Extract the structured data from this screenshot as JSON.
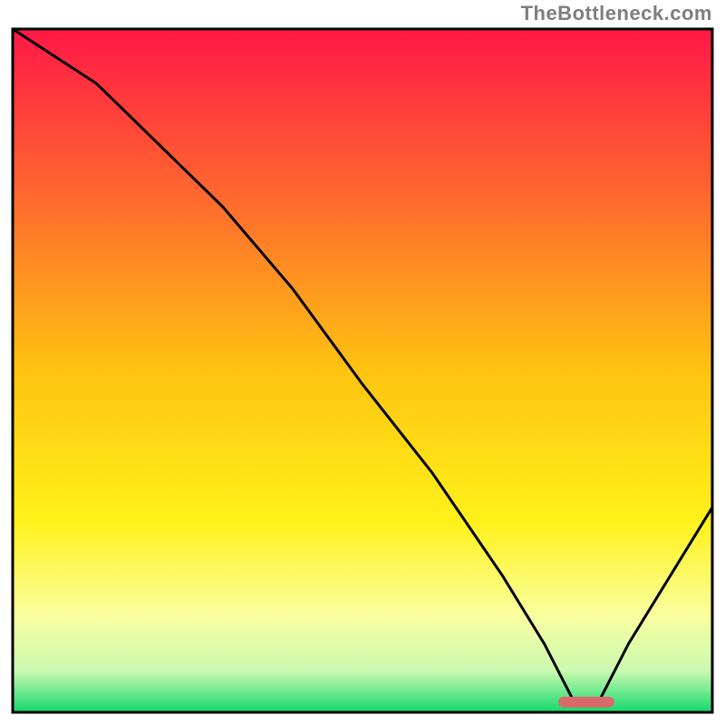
{
  "attribution": "TheBottleneck.com",
  "chart_data": {
    "type": "line",
    "title": "",
    "xlabel": "",
    "ylabel": "",
    "xlim": [
      0,
      100
    ],
    "ylim": [
      0,
      100
    ],
    "grid": false,
    "legend": false,
    "series": [
      {
        "name": "bottleneck-curve",
        "x": [
          0,
          12,
          24,
          30,
          40,
          50,
          60,
          70,
          76,
          80,
          84,
          88,
          100
        ],
        "y": [
          100,
          92,
          80,
          74,
          62,
          48,
          35,
          20,
          10,
          2,
          2,
          10,
          30
        ]
      }
    ],
    "marker": {
      "name": "optimal-range",
      "x_start": 78,
      "x_end": 86,
      "y": 1.5,
      "color": "#d86a6a"
    },
    "background_gradient": {
      "stops": [
        {
          "offset": 0.0,
          "color": "#ff1846"
        },
        {
          "offset": 0.25,
          "color": "#ff6a2e"
        },
        {
          "offset": 0.5,
          "color": "#ffc310"
        },
        {
          "offset": 0.72,
          "color": "#fff11a"
        },
        {
          "offset": 0.86,
          "color": "#f9ffa0"
        },
        {
          "offset": 0.94,
          "color": "#c9f9b0"
        },
        {
          "offset": 1.0,
          "color": "#14d96d"
        }
      ]
    },
    "frame_color": "#000000"
  }
}
